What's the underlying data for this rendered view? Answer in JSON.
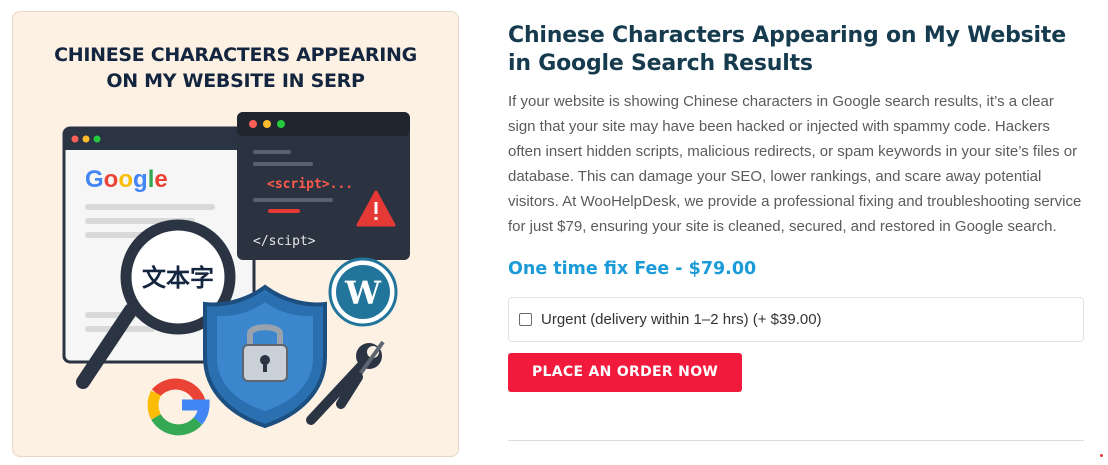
{
  "hero": {
    "title_line1": "CHINESE CHARACTERS APPEARING",
    "title_line2": "ON MY WEBSITE IN SERP",
    "browser_logo_text": "Google",
    "magnifier_text": "文本字",
    "code_open": "<script>...",
    "code_close": "</scipt>",
    "icons": [
      "google-logo-icon",
      "magnifier-icon",
      "warning-icon",
      "wordpress-icon",
      "shield-lock-icon",
      "wrench-icon",
      "screwdriver-icon"
    ],
    "colors": {
      "navy": "#14263f",
      "shield_blue": "#2a6fb0",
      "warning_red": "#e53935",
      "google_blue": "#4285f4"
    }
  },
  "product": {
    "title": "Chinese Characters Appearing on My Website in Google Search Results",
    "description": "If your website is showing Chinese characters in Google search results, it’s a clear sign that your site may have been hacked or injected with spammy code. Hackers often insert hidden scripts, malicious redirects, or spam keywords in your site’s files or database. This can damage your SEO, lower rankings, and scare away potential visitors. At WooHelpDesk, we provide a professional fixing and troubleshooting service for just $79, ensuring your site is cleaned, secured, and restored in Google search.",
    "price_label": "One time fix Fee - $79.00",
    "addon_label": "Urgent (delivery within 1–2 hrs) (+ $39.00)",
    "addon_checked": false,
    "order_button": "PLACE AN ORDER NOW",
    "colors": {
      "title": "#163b4e",
      "price": "#1b9bd8",
      "button": "#f21a3c"
    }
  }
}
